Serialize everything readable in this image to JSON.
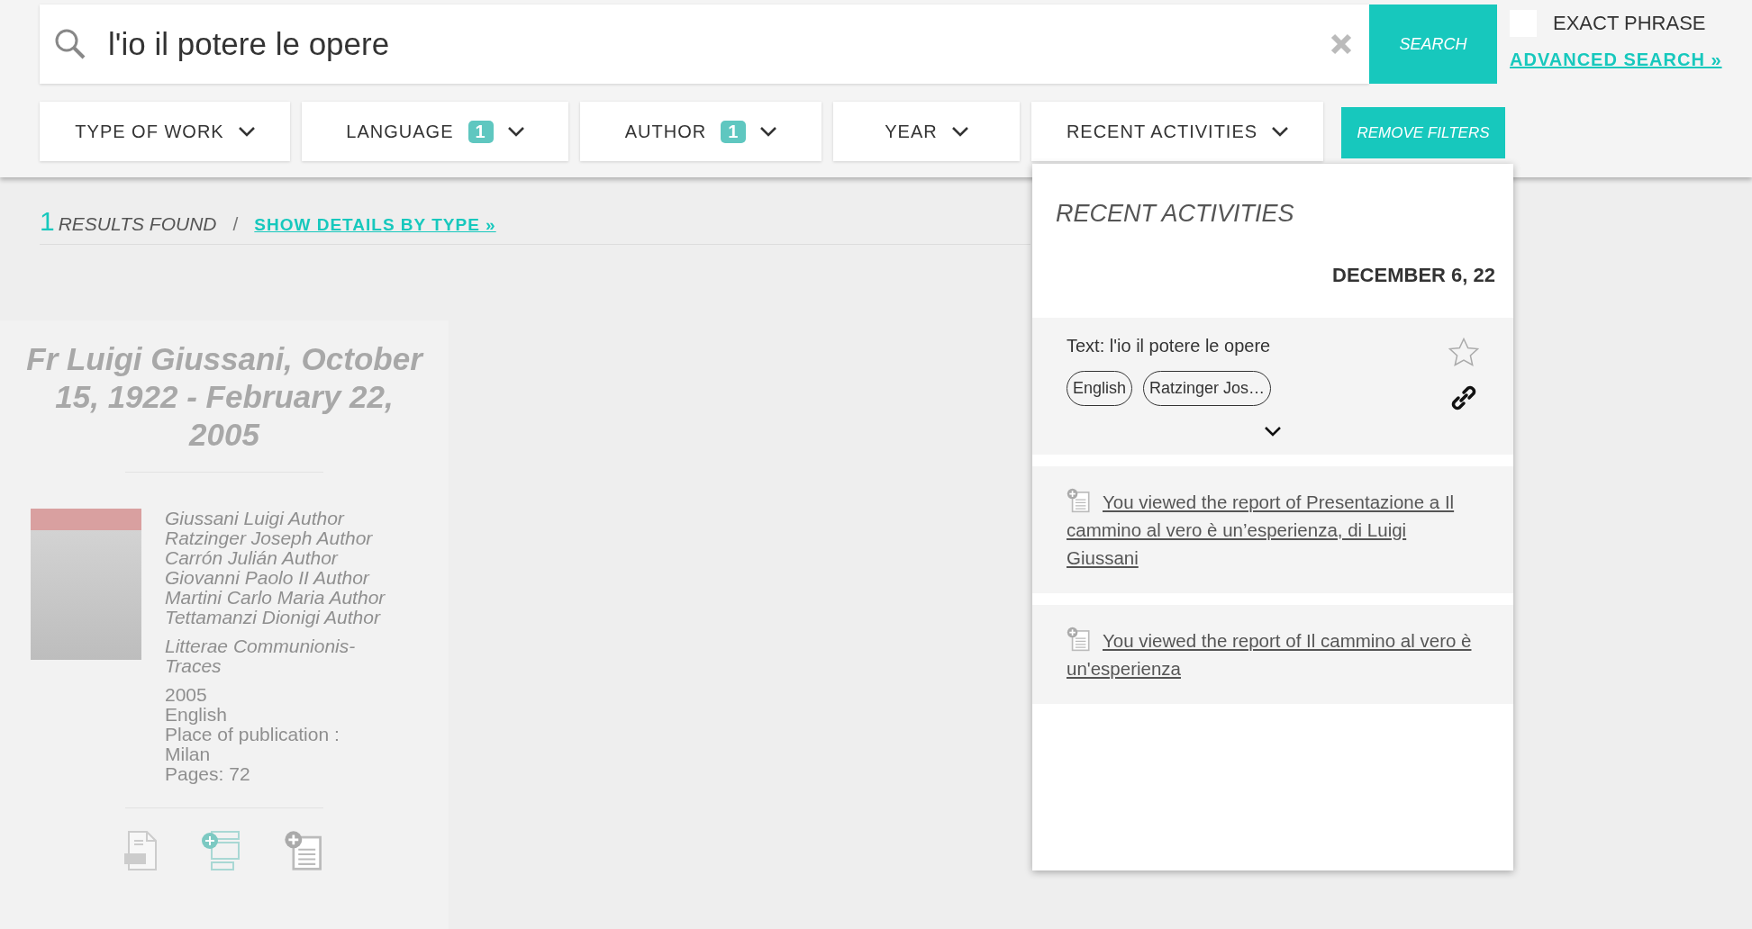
{
  "search": {
    "value": "l'io il potere le opere",
    "button": "SEARCH"
  },
  "exact_phrase": {
    "label": "EXACT PHRASE",
    "checked": false
  },
  "advanced_search": "ADVANCED SEARCH »",
  "filters": [
    {
      "label": "TYPE OF WORK"
    },
    {
      "label": "LANGUAGE",
      "count": "1"
    },
    {
      "label": "AUTHOR",
      "count": "1"
    },
    {
      "label": "YEAR"
    },
    {
      "label": "RECENT ACTIVITIES"
    }
  ],
  "remove_filters": "REMOVE FILTERS",
  "results": {
    "count": "1",
    "label": "RESULTS FOUND",
    "separator": "/",
    "details_link": "SHOW DETAILS BY TYPE »"
  },
  "result_card": {
    "title": "Fr Luigi Giussani, October 15, 1922 - February 22, 2005",
    "authors": [
      "Giussani Luigi Author",
      "Ratzinger Joseph Author",
      "Carrón Julián Author",
      "Giovanni Paolo II Author",
      "Martini Carlo Maria Author",
      "Tettamanzi Dionigi Author"
    ],
    "series": "Litterae Communionis-Traces",
    "details": [
      "2005",
      "English",
      "Place of publication : Milan",
      "Pages: 72"
    ]
  },
  "recent_activities": {
    "title": "RECENT ACTIVITIES",
    "date": "DECEMBER 6, 22",
    "items": [
      {
        "kind": "search",
        "text": "Text: l'io il potere le opere",
        "tags": [
          "English",
          "Ratzinger Jos…"
        ],
        "starred": false
      },
      {
        "kind": "viewed",
        "text": "You viewed the report of Presentazione a Il cammino al vero è un’esperienza, di Luigi Giussani"
      },
      {
        "kind": "viewed",
        "text": "You viewed the report of Il cammino al vero è un'esperienza"
      }
    ]
  }
}
